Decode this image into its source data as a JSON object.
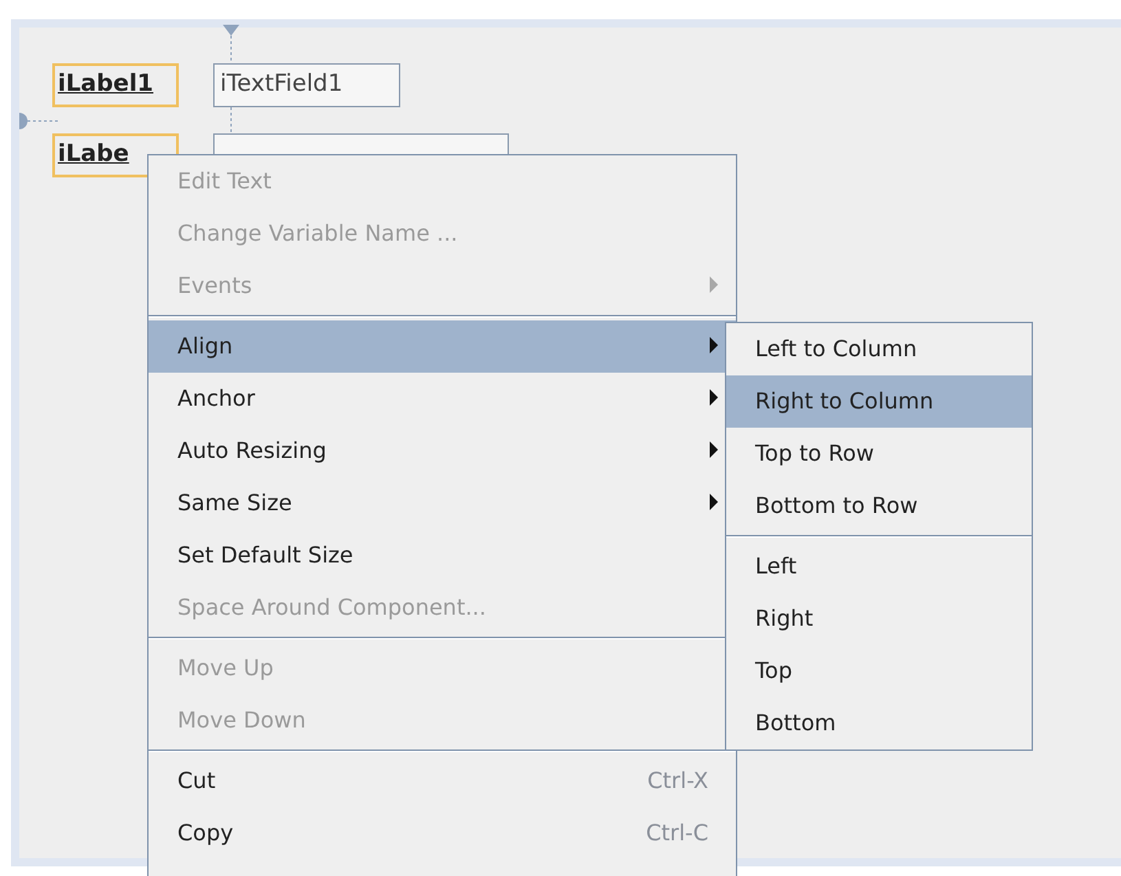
{
  "form": {
    "components": [
      {
        "kind": "label",
        "text": "iLabel1",
        "selected": true
      },
      {
        "kind": "textfield",
        "text": "iTextField1",
        "selected": false
      },
      {
        "kind": "label",
        "text": "iLabe",
        "selected": true
      },
      {
        "kind": "textfield",
        "selected": false
      }
    ]
  },
  "context_menu": {
    "groups": [
      [
        {
          "label": "Edit Text",
          "disabled": true,
          "submenu": false,
          "selected": false
        },
        {
          "label": "Change Variable Name ...",
          "disabled": true,
          "submenu": false,
          "selected": false
        },
        {
          "label": "Events",
          "disabled": true,
          "submenu": true,
          "selected": false
        }
      ],
      [
        {
          "label": "Align",
          "disabled": false,
          "submenu": true,
          "selected": true
        },
        {
          "label": "Anchor",
          "disabled": false,
          "submenu": true,
          "selected": false
        },
        {
          "label": "Auto Resizing",
          "disabled": false,
          "submenu": true,
          "selected": false
        },
        {
          "label": "Same Size",
          "disabled": false,
          "submenu": true,
          "selected": false
        },
        {
          "label": "Set Default Size",
          "disabled": false,
          "submenu": false,
          "selected": false
        },
        {
          "label": "Space Around Component...",
          "disabled": true,
          "submenu": false,
          "selected": false
        }
      ],
      [
        {
          "label": "Move Up",
          "disabled": true,
          "submenu": false,
          "selected": false
        },
        {
          "label": "Move Down",
          "disabled": true,
          "submenu": false,
          "selected": false
        }
      ],
      [
        {
          "label": "Cut",
          "shortcut": "Ctrl-X",
          "disabled": false,
          "submenu": false,
          "selected": false
        },
        {
          "label": "Copy",
          "shortcut": "Ctrl-C",
          "disabled": false,
          "submenu": false,
          "selected": false
        }
      ]
    ]
  },
  "submenu": {
    "groups": [
      [
        {
          "label": "Left to Column",
          "selected": false
        },
        {
          "label": "Right to Column",
          "selected": true
        },
        {
          "label": "Top to Row",
          "selected": false
        },
        {
          "label": "Bottom to Row",
          "selected": false
        }
      ],
      [
        {
          "label": "Left",
          "selected": false
        },
        {
          "label": "Right",
          "selected": false
        },
        {
          "label": "Top",
          "selected": false
        },
        {
          "label": "Bottom",
          "selected": false
        }
      ]
    ]
  }
}
